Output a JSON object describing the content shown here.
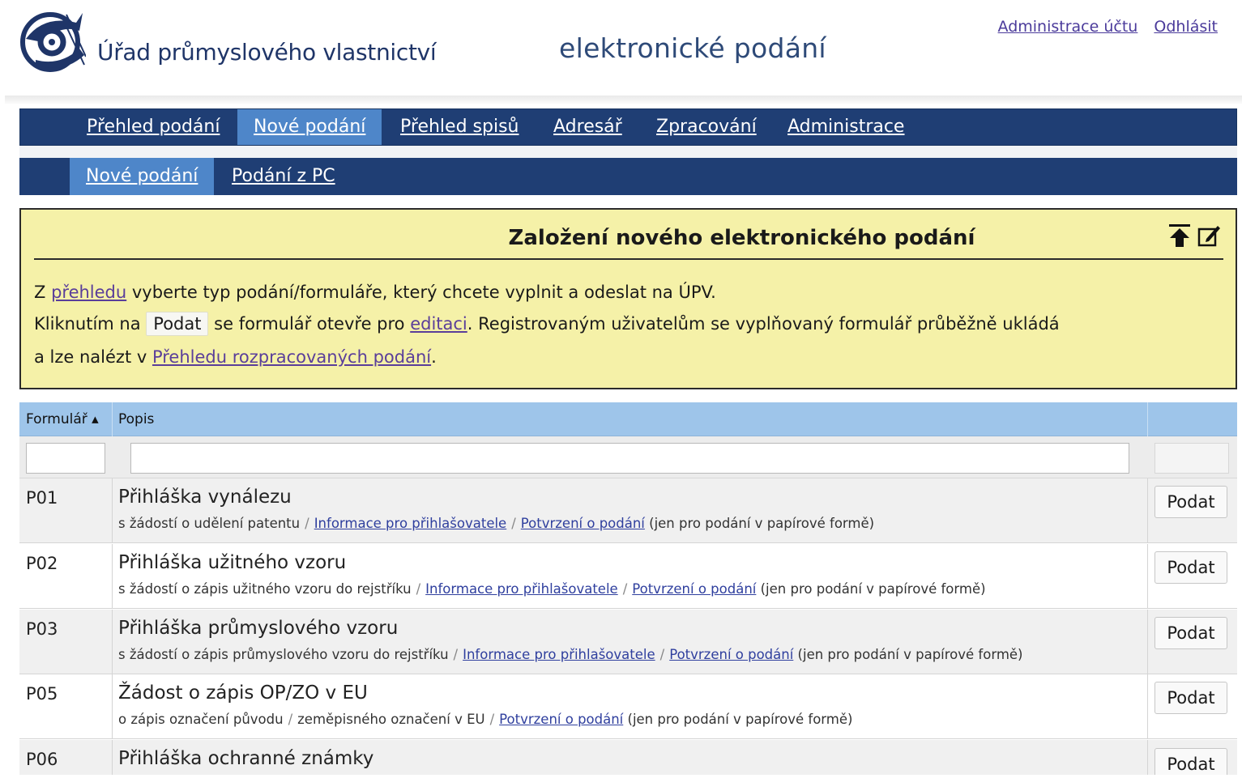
{
  "header": {
    "org_name": "Úřad průmyslového vlastnictví",
    "app_title": "elektronické podání",
    "links": [
      "Administrace účtu",
      "Odhlásit"
    ]
  },
  "nav_main": {
    "items": [
      "Přehled podání",
      "Nové podání",
      "Přehled spisů",
      "Adresář",
      "Zpracování",
      "Administrace"
    ],
    "active": "Nové podání"
  },
  "nav_sub": {
    "items": [
      "Nové podání",
      "Podání z PC"
    ],
    "active": "Nové podání"
  },
  "info": {
    "title": "Založení nového elektronického podání",
    "line1_pre": "Z ",
    "line1_link": "přehledu",
    "line1_post": " vyberte typ podání/formuláře, který chcete vyplnit a odeslat na ÚPV.",
    "line2_pre": "Kliknutím na ",
    "line2_button": "Podat",
    "line2_mid": " se formulář otevře pro ",
    "line2_link": "editaci",
    "line2_post": ". Registrovaným uživatelům se vyplňovaný formulář průběžně ukládá",
    "line3_pre": " a lze nalézt v ",
    "line3_link": "Přehledu rozpracovaných podání",
    "line3_post": "."
  },
  "table": {
    "col_form": "Formulář ▴",
    "col_desc": "Popis",
    "rows": [
      {
        "code": "P01",
        "title": "Přihláška vynálezu",
        "desc": "s žádostí o udělení patentu",
        "link1": "Informace pro přihlašovatele",
        "link2": "Potvrzení o podání",
        "note": " (jen pro podání v papírové formě)",
        "button": "Podat"
      },
      {
        "code": "P02",
        "title": "Přihláška užitného vzoru",
        "desc": "s žádostí o zápis užitného vzoru do rejstříku",
        "link1": "Informace pro přihlašovatele",
        "link2": "Potvrzení o podání",
        "note": " (jen pro podání v papírové formě)",
        "button": "Podat"
      },
      {
        "code": "P03",
        "title": "Přihláška průmyslového vzoru",
        "desc": "s žádostí o zápis průmyslového vzoru do rejstříku",
        "link1": "Informace pro přihlašovatele",
        "link2": "Potvrzení o podání",
        "note": " (jen pro podání v papírové formě)",
        "button": "Podat"
      },
      {
        "code": "P05",
        "title": "Žádost o zápis OP/ZO v EU",
        "desc": "o zápis označení původu",
        "desc2": "zeměpisného označení v EU",
        "link2": "Potvrzení o podání",
        "note": " (jen pro podání v papírové formě)",
        "button": "Podat"
      },
      {
        "code": "P06",
        "title": "Přihláška ochranné známky",
        "button": "Podat"
      }
    ]
  },
  "colors": {
    "nav_bg": "#1f3e74",
    "nav_active": "#4e86c9",
    "panel_bg": "#f5f1a8",
    "table_header": "#9ec5ea"
  }
}
